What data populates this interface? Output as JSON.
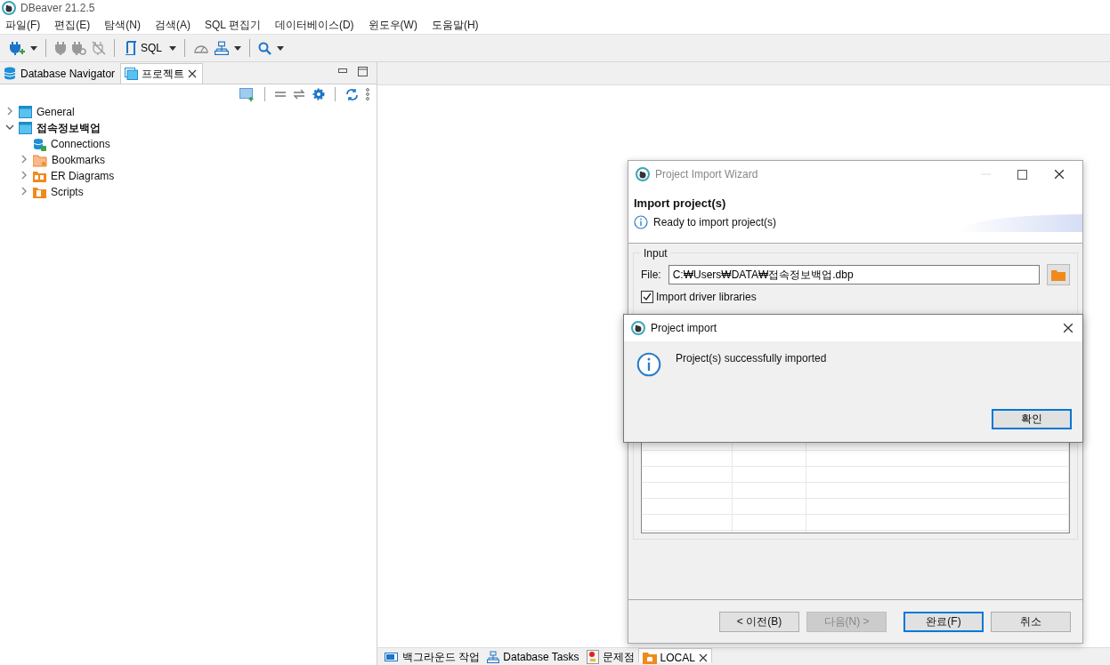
{
  "window": {
    "title": "DBeaver 21.2.5"
  },
  "menu": [
    {
      "label": "파일(F)"
    },
    {
      "label": "편집(E)"
    },
    {
      "label": "탐색(N)"
    },
    {
      "label": "검색(A)"
    },
    {
      "label": "SQL 편집기"
    },
    {
      "label": "데이터베이스(D)"
    },
    {
      "label": "윈도우(W)"
    },
    {
      "label": "도움말(H)"
    }
  ],
  "toolbar": {
    "sql_label": "SQL"
  },
  "left_panel": {
    "tabs": [
      {
        "label": "Database Navigator",
        "selected": false
      },
      {
        "label": "프로젝트",
        "selected": true
      }
    ],
    "tree": [
      {
        "label": "General",
        "kind": "project",
        "active": false,
        "expanded": false
      },
      {
        "label": "접속정보백업",
        "kind": "project",
        "active": true,
        "expanded": true,
        "children": [
          {
            "label": "Connections",
            "kind": "connections"
          },
          {
            "label": "Bookmarks",
            "kind": "bookmarks",
            "expanded": false
          },
          {
            "label": "ER Diagrams",
            "kind": "diagrams",
            "expanded": false
          },
          {
            "label": "Scripts",
            "kind": "scripts",
            "expanded": false
          }
        ]
      }
    ]
  },
  "bottom_tabs": [
    {
      "label": "백그라운드 작업",
      "kind": "progress",
      "selected": false
    },
    {
      "label": "Database Tasks",
      "kind": "tasks",
      "selected": false
    },
    {
      "label": "문제점",
      "kind": "problems",
      "selected": false
    },
    {
      "label": "LOCAL",
      "kind": "editor",
      "selected": true
    }
  ],
  "wizard": {
    "title": "Project Import Wizard",
    "heading": "Import project(s)",
    "message": "Ready to import project(s)",
    "group_label": "Input",
    "file_label": "File:",
    "file_value": "C:₩Users₩DATA₩접속정보백업.dbp",
    "import_driver_libraries": {
      "label": "Import driver libraries",
      "checked": true
    },
    "buttons": [
      {
        "label": "< 이전(B)",
        "disabled": false,
        "default": false
      },
      {
        "label": "다음(N) >",
        "disabled": true,
        "default": false
      },
      {
        "label": "완료(F)",
        "disabled": false,
        "default": true
      },
      {
        "label": "취소",
        "disabled": false,
        "default": false
      }
    ]
  },
  "dialog": {
    "title": "Project import",
    "message": "Project(s) successfully imported",
    "button": "확인"
  }
}
